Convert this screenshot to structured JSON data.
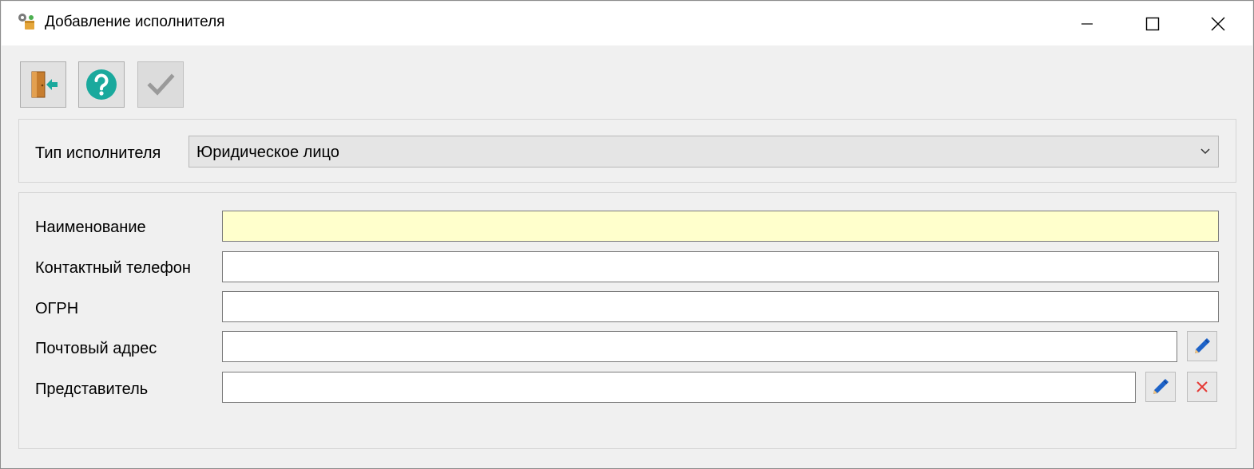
{
  "window": {
    "title": "Добавление исполнителя",
    "controls": [
      "minimize",
      "maximize",
      "close"
    ]
  },
  "toolbar": {
    "buttons": [
      {
        "name": "exit",
        "icon": "exit-door-icon",
        "enabled": true
      },
      {
        "name": "help",
        "icon": "help-icon",
        "enabled": true
      },
      {
        "name": "confirm",
        "icon": "checkmark-icon",
        "enabled": false
      }
    ]
  },
  "executor_type": {
    "label": "Тип исполнителя",
    "value": "Юридическое лицо"
  },
  "fields": {
    "name": {
      "label": "Наименование",
      "value": "",
      "required": true
    },
    "phone": {
      "label": "Контактный телефон",
      "value": ""
    },
    "ogrn": {
      "label": "ОГРН",
      "value": ""
    },
    "postal_address": {
      "label": "Почтовый адрес",
      "value": ""
    },
    "representative": {
      "label": "Представитель",
      "value": ""
    }
  },
  "colors": {
    "required_field_bg": "#ffffcc",
    "help_icon": "#1aa99d",
    "delete_icon": "#e53935",
    "edit_icon": "#1e63c8"
  }
}
